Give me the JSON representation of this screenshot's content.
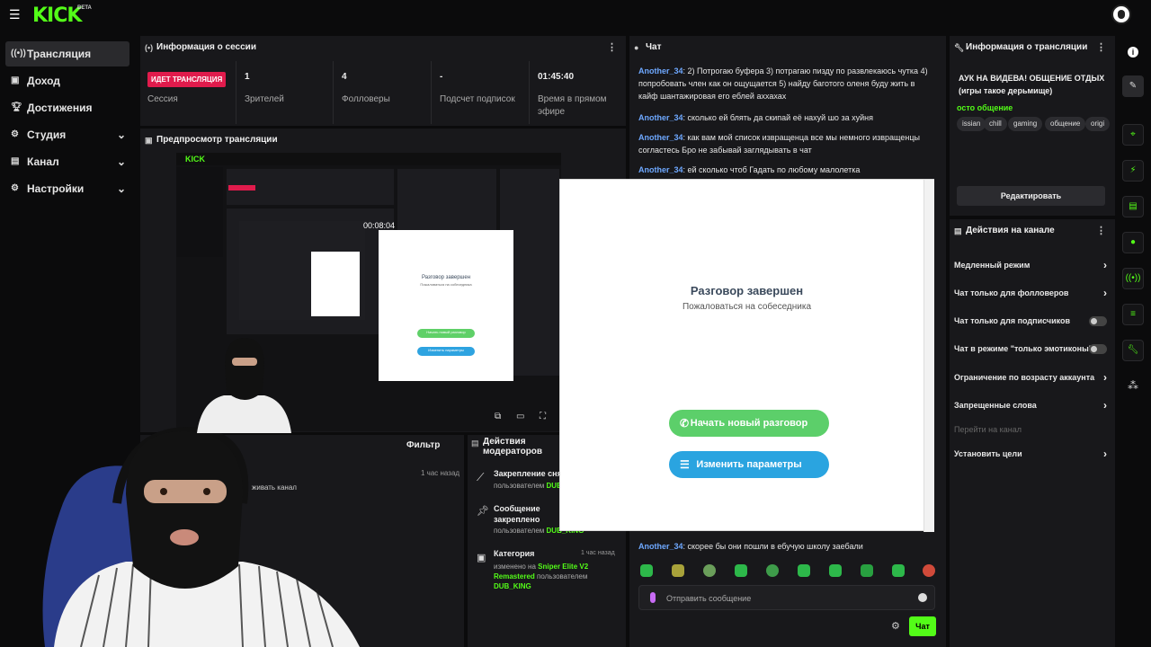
{
  "brand": {
    "logo": "KICK",
    "beta": "BETA"
  },
  "sidebar": {
    "items": [
      {
        "label": "Трансляция",
        "icon": "broadcast-icon",
        "active": true
      },
      {
        "label": "Доход",
        "icon": "wallet-icon"
      },
      {
        "label": "Достижения",
        "icon": "trophy-icon"
      },
      {
        "label": "Студия",
        "icon": "gear-icon",
        "has_submenu": true
      },
      {
        "label": "Канал",
        "icon": "channel-icon",
        "has_submenu": true
      },
      {
        "label": "Настройки",
        "icon": "settings-icon",
        "has_submenu": true
      }
    ]
  },
  "session": {
    "title": "Информация о сессии",
    "live_badge": "ИДЕТ ТРАНСЛЯЦИЯ",
    "live_label": "Сессия",
    "viewers_value": "1",
    "viewers_label": "Зрителей",
    "followers_value": "4",
    "followers_label": "Фолловеры",
    "subs_value": "-",
    "subs_label": "Подсчет подписок",
    "time_value": "01:45:40",
    "time_label": "Время в прямом эфире"
  },
  "preview": {
    "title": "Предпросмотр трансляции"
  },
  "activity": {
    "filter_label": "Фильтр",
    "time": "1 час назад",
    "text": "живать канал"
  },
  "mod_actions": {
    "title": "Действия модераторов",
    "items": [
      {
        "title": "Закрепление сня",
        "by_prefix": "пользователем",
        "by_user": "DUB_"
      },
      {
        "title": "Сообщение закреплено",
        "by_prefix": "пользователем",
        "by_user": "DUB_KING"
      },
      {
        "title": "Категория",
        "time": "1 час назад",
        "changed_prefix": "изменено на",
        "category": "Sniper Elite V2 Remastered",
        "by_prefix": "пользователем",
        "by_user": "DUB_KING"
      }
    ]
  },
  "chat": {
    "title": "Чат",
    "messages": [
      {
        "user": "Another_34",
        "text": ": 2) Потрогаю буфера 3) потрагаю пизду по развлекаюсь чутка 4) попробовать член как он ощущается 5) найду баготого оленя буду жить в кайф шантажировая его еблей аххахах"
      },
      {
        "user": "Another_34",
        "text": ": сколько ей блять да скипай её нахуй шо за хуйня"
      },
      {
        "user": "Another_34",
        "text": ": как вам мой список извращенца все мы немного извращенцы согластесь Бро не забывай заглядывать в чат"
      },
      {
        "user": "Another_34",
        "text": ": ей сколько чтоб Гадать по любому малолетка"
      },
      {
        "user": "Another_34",
        "text": ": скорее бы они пошли в ебучую школу заебали"
      }
    ],
    "input_placeholder": "Отправить сообщение",
    "send_label": "Чат"
  },
  "stream_info": {
    "title": "Информация о трансляции",
    "stream_title": "АУК НА ВИДЕВА! ОБЩЕНИЕ ОТДЫХ (игры такое дерьмище)",
    "category": "осто общение",
    "tags": [
      "issian",
      "chill",
      "gaming",
      "общение",
      "origi"
    ],
    "edit_label": "Редактировать"
  },
  "channel_actions": {
    "title": "Действия на канале",
    "items": [
      {
        "label": "Медленный режим",
        "control": "chevron"
      },
      {
        "label": "Чат только для фолловеров",
        "control": "chevron"
      },
      {
        "label": "Чат только для подписчиков",
        "control": "toggle"
      },
      {
        "label": "Чат в режиме \"только эмотиконы\"",
        "control": "toggle"
      },
      {
        "label": "Ограничение по возрасту аккаунта",
        "control": "chevron"
      },
      {
        "label": "Запрещенные слова",
        "control": "chevron"
      },
      {
        "label": "Перейти на канал",
        "control": "none",
        "disabled": true
      },
      {
        "label": "Установить цели",
        "control": "chevron"
      }
    ]
  },
  "popup": {
    "title": "Разговор завершен",
    "subtitle": "Пожаловаться на собеседника",
    "new_chat": "Начать новый разговор",
    "change_params": "Изменить параметры"
  },
  "preview_inner": {
    "popup_title": "Разговор завершен",
    "popup_sub": "Пожаловаться на собеседника",
    "new_chat": "Начать новый разговор",
    "change_params": "Изменить параметры",
    "time": "00:08:04"
  },
  "colors": {
    "accent": "#53fc18",
    "live": "#e01b4c",
    "username": "#6ea8ff",
    "panel": "#18181b"
  }
}
